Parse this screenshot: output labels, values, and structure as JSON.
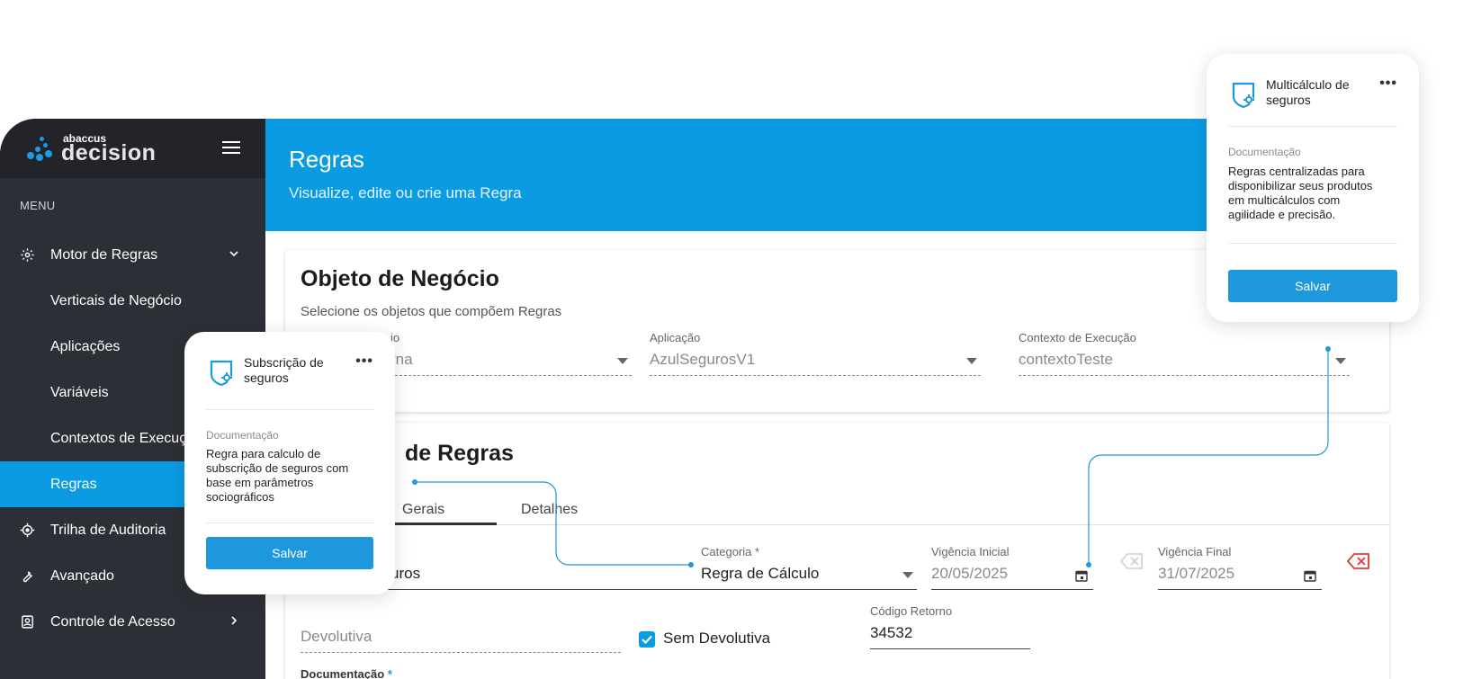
{
  "brand": {
    "small": "abaccus",
    "name": "decision",
    "accent": "#0b9be2"
  },
  "sidebar": {
    "menu_label": "MENU",
    "items": [
      {
        "label": "Motor de Regras",
        "icon": "gear-icon"
      },
      {
        "label": "Verticais de Negócio"
      },
      {
        "label": "Aplicações"
      },
      {
        "label": "Variáveis"
      },
      {
        "label": "Contextos de Execução"
      },
      {
        "label": "Regras"
      },
      {
        "label": "Trilha de Auditoria",
        "icon": "target-icon"
      },
      {
        "label": "Avançado",
        "icon": "wrench-icon"
      },
      {
        "label": "Controle de Acesso",
        "icon": "badge-icon"
      }
    ]
  },
  "header": {
    "title": "Regras",
    "subtitle": "Visualize, edite ou crie uma Regra"
  },
  "business_object": {
    "title": "Objeto de Negócio",
    "subtitle": "Selecione os objetos que compõem Regras",
    "fields": [
      {
        "label": "io",
        "value": "rna"
      },
      {
        "label": "Aplicação",
        "value": "AzulSegurosV1"
      },
      {
        "label": "Contexto de Execução",
        "value": "contextoTeste"
      }
    ]
  },
  "rules": {
    "title": "de Regras",
    "tabs": [
      {
        "label": "Gerais"
      },
      {
        "label": "Detalhes"
      }
    ],
    "name_value": "uros",
    "category": {
      "label": "Categoria *",
      "value": "Regra de Cálculo"
    },
    "start": {
      "label": "Vigência Inicial",
      "value": "20/05/2025"
    },
    "end": {
      "label": "Vigência Final",
      "value": "31/07/2025"
    },
    "devolutiva_placeholder": "Devolutiva",
    "sem_devolutiva": "Sem Devolutiva",
    "codigo": {
      "label": "Código Retorno",
      "value": "34532"
    },
    "doc_label": "Documentação",
    "doc_required": "*"
  },
  "popup_a": {
    "title": "Subscrição de seguros",
    "more": "•••",
    "doc_label": "Documentação",
    "doc_text": "Regra para calculo de subscrição de seguros com base em parâmetros sociográficos",
    "save": "Salvar"
  },
  "popup_b": {
    "title": "Multicálculo de seguros",
    "more": "•••",
    "doc_label": "Documentação",
    "doc_text": "Regras centralizadas para disponibilizar seus produtos em multicálculos com agilidade e precisão.",
    "save": "Salvar"
  }
}
